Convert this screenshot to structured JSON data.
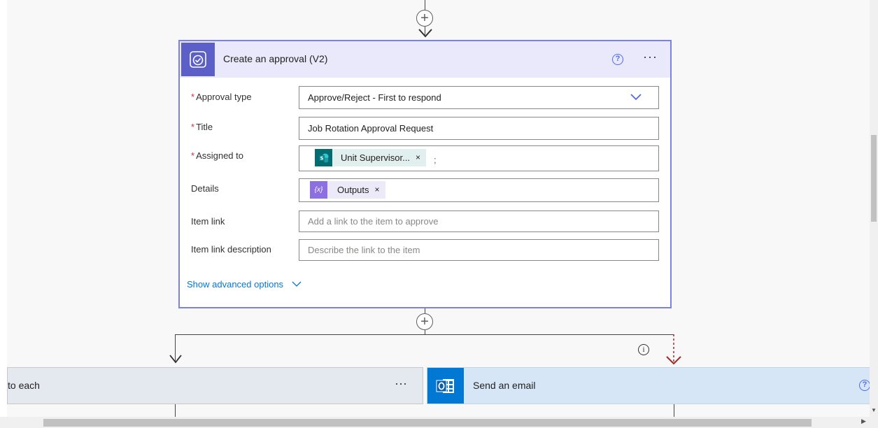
{
  "approval_card": {
    "title": "Create an approval (V2)",
    "help_glyph": "?",
    "more_glyph": "···",
    "fields": {
      "approval_type": {
        "label": "Approval type",
        "required_mark": "*",
        "value": "Approve/Reject - First to respond"
      },
      "title": {
        "label": "Title",
        "required_mark": "*",
        "value": "Job Rotation Approval Request"
      },
      "assigned_to": {
        "label": "Assigned to",
        "required_mark": "*",
        "token": "Unit Supervisor...",
        "token_remove": "×",
        "separator": ";"
      },
      "details": {
        "label": "Details",
        "token": "Outputs",
        "token_remove": "×"
      },
      "item_link": {
        "label": "Item link",
        "placeholder": "Add a link to the item to approve"
      },
      "item_link_description": {
        "label": "Item link description",
        "placeholder": "Describe the link to the item"
      }
    },
    "show_advanced": "Show advanced options"
  },
  "apply_to_each": {
    "label": "to each",
    "more_glyph": "···"
  },
  "send_email": {
    "label": "Send an email",
    "help_glyph": "?"
  },
  "connectors": {
    "plus_glyph": "+",
    "info_glyph": "i"
  },
  "colors": {
    "approval_accent": "#5b5fc7",
    "card_border": "#7c82e0",
    "email_accent": "#0078d4",
    "required": "#d13438",
    "link": "#0078d4",
    "dashed_arrow": "#a4262c"
  },
  "icons": {
    "approval": "approval-check-icon",
    "sharepoint": "sharepoint-icon",
    "expression": "expression-icon",
    "outlook": "outlook-icon"
  }
}
